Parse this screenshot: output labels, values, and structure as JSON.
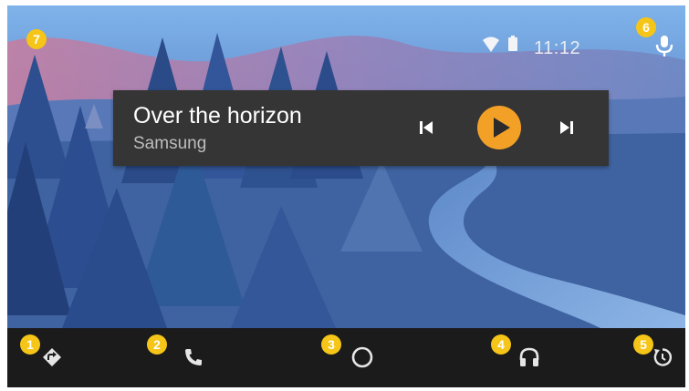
{
  "status_bar": {
    "time": "11:12",
    "icons": [
      "wifi-icon",
      "battery-icon"
    ],
    "mic_icon": "mic-icon"
  },
  "media_card": {
    "title": "Over the horizon",
    "artist": "Samsung",
    "controls": [
      "skip-previous-icon",
      "play-icon",
      "skip-next-icon"
    ],
    "play_button_color": "#f3a026"
  },
  "nav_bar": {
    "items": [
      {
        "icon": "navigation-icon"
      },
      {
        "icon": "phone-icon"
      },
      {
        "icon": "home-circle-icon"
      },
      {
        "icon": "headphones-icon"
      },
      {
        "icon": "exit-icon"
      }
    ]
  },
  "callouts": [
    "1",
    "2",
    "3",
    "4",
    "5",
    "6",
    "7"
  ],
  "colors": {
    "callout_badge": "#f5c518",
    "nav_bar": "#1b1b1b",
    "card_bg": "#353535"
  }
}
